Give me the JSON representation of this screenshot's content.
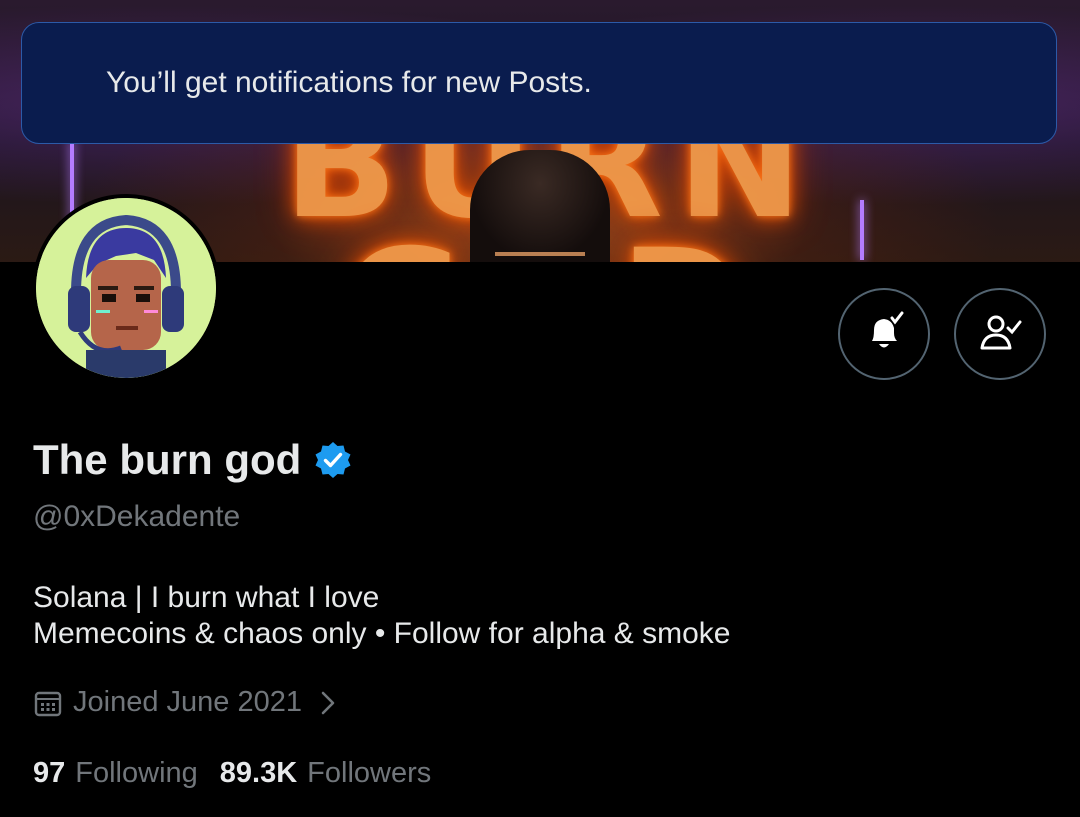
{
  "toast": {
    "message": "You’ll get notifications for new Posts."
  },
  "banner": {
    "text": "BURN GOD"
  },
  "profile": {
    "display_name": "The burn god",
    "handle": "@0xDekadente",
    "bio_line_1": "Solana | I burn what I love",
    "bio_line_2": "Memecoins & chaos only • Follow for alpha & smoke",
    "joined": "Joined June 2021",
    "following_count": "97",
    "following_label": "Following",
    "followers_count": "89.3K",
    "followers_label": "Followers"
  },
  "icons": {
    "verified": "verified-badge-icon",
    "notifications": "bell-check-icon",
    "following": "person-check-icon",
    "calendar": "calendar-icon",
    "chevron": "chevron-right-icon"
  },
  "colors": {
    "background": "#000000",
    "toast_bg": "#0a1c4e",
    "verified_blue": "#1d9bf0",
    "muted_text": "#71767b"
  }
}
